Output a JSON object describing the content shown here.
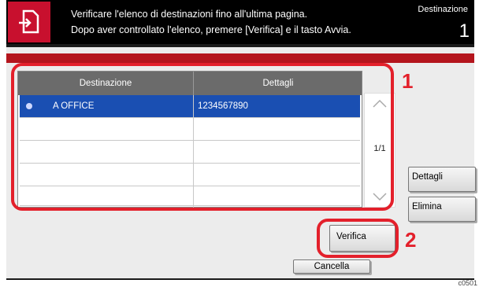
{
  "header": {
    "message_line1": "Verificare l'elenco di destinazioni fino all'ultima pagina.",
    "message_line2": "Dopo aver controllato l'elenco, premere [Verifica] e il tasto Avvia.",
    "dest_label": "Destinazione",
    "dest_count": "1"
  },
  "table": {
    "col_destination": "Destinazione",
    "col_details": "Dettagli",
    "rows": [
      {
        "destination": "A OFFICE",
        "details": "1234567890"
      },
      {
        "destination": "",
        "details": ""
      },
      {
        "destination": "",
        "details": ""
      },
      {
        "destination": "",
        "details": ""
      },
      {
        "destination": "",
        "details": ""
      }
    ],
    "page_indicator": "1/1"
  },
  "buttons": {
    "details": "Dettagli",
    "delete": "Elimina",
    "verify": "Verifica",
    "cancel": "Cancella"
  },
  "callouts": {
    "one": "1",
    "two": "2"
  },
  "corner_label": "c0501"
}
